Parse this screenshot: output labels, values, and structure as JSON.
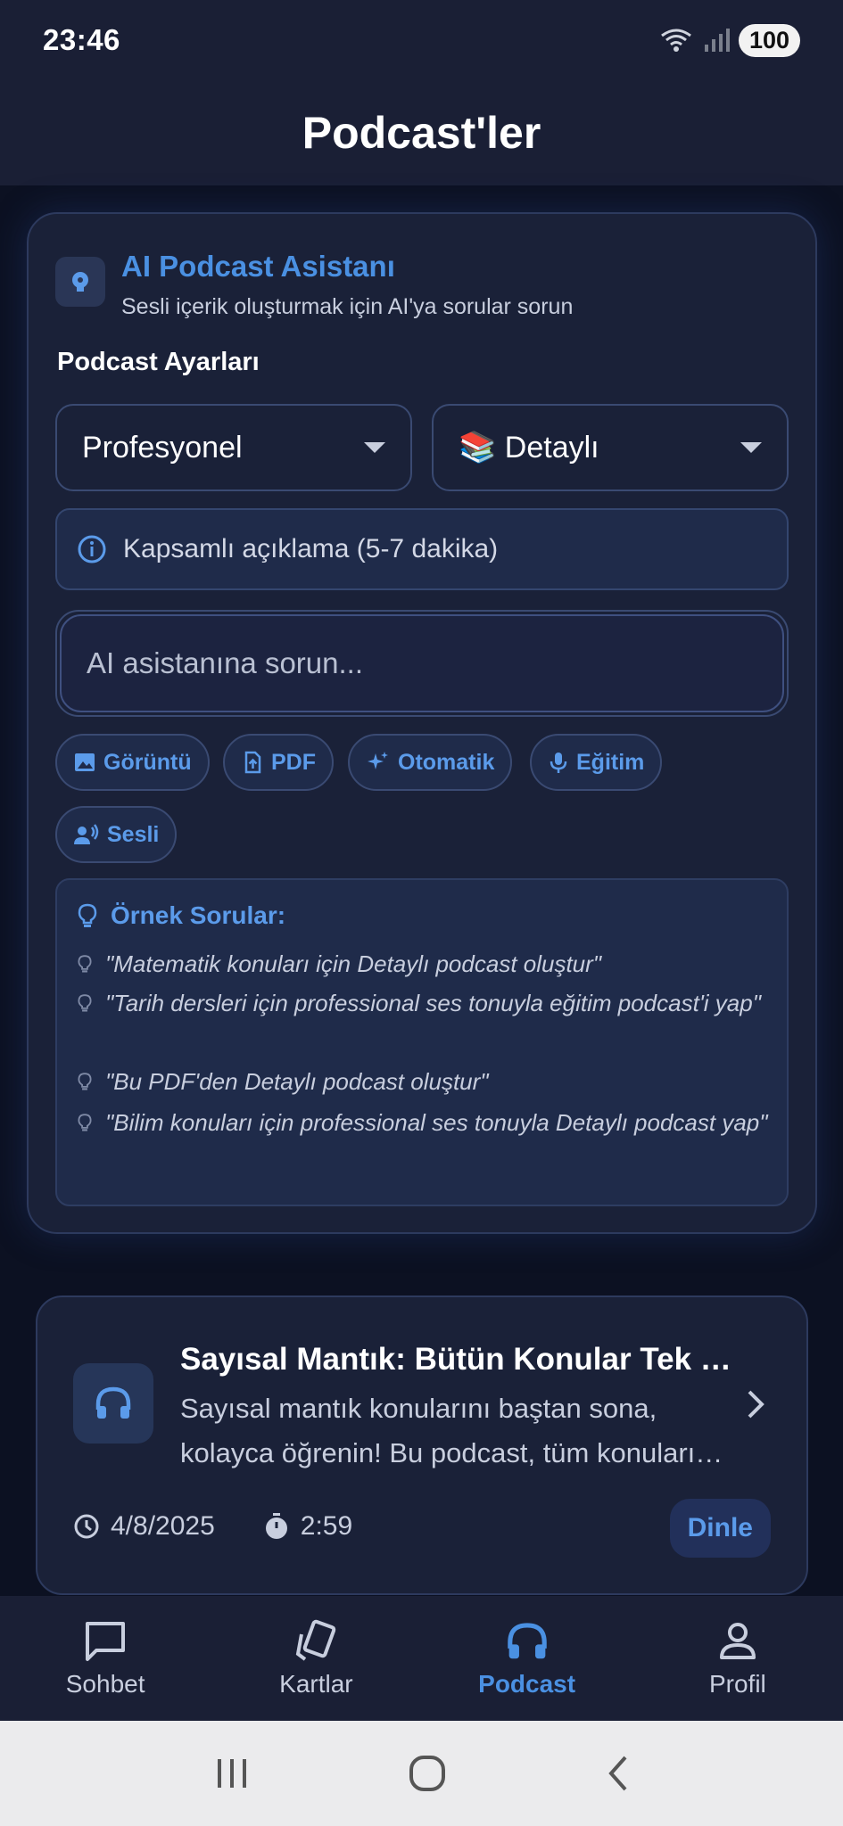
{
  "status": {
    "time": "23:46",
    "battery": "100"
  },
  "header": {
    "title": "Podcast'ler"
  },
  "assistant": {
    "title": "AI Podcast Asistanı",
    "subtitle": "Sesli içerik oluşturmak için AI'ya sorular sorun",
    "settings_label": "Podcast Ayarları",
    "tone_select": "Profesyonel",
    "length_select": "📚 Detaylı",
    "info": "Kapsamlı açıklama (5-7 dakika)",
    "input_placeholder": "AI asistanına sorun...",
    "chips": [
      "Görüntü",
      "PDF",
      "Otomatik",
      "Eğitim",
      "Sesli"
    ],
    "examples_title": "Örnek Sorular:",
    "examples": [
      "\"Matematik konuları için Detaylı podcast oluştur\"",
      "\"Tarih dersleri için professional ses tonuyla eğitim podcast'i yap\"",
      "\"Bu PDF'den Detaylı podcast oluştur\"",
      "\"Bilim konuları için professional ses tonuyla Detaylı podcast yap\""
    ]
  },
  "podcast": {
    "title": "Sayısal Mantık: Bütün Konular Tek Podcastte",
    "description": "Sayısal mantık konularını baştan sona, kolayca öğrenin! Bu podcast, tüm konuları kapsıyor.",
    "date": "4/8/2025",
    "duration": "2:59",
    "listen": "Dinle"
  },
  "nav": {
    "items": [
      {
        "label": "Sohbet",
        "icon": "chat-icon"
      },
      {
        "label": "Kartlar",
        "icon": "cards-icon"
      },
      {
        "label": "Podcast",
        "icon": "headphones-icon"
      },
      {
        "label": "Profil",
        "icon": "person-icon"
      }
    ],
    "active": "Podcast"
  },
  "colors": {
    "accent": "#4a90e2",
    "background": "#0c1122",
    "card": "#1a2138"
  }
}
